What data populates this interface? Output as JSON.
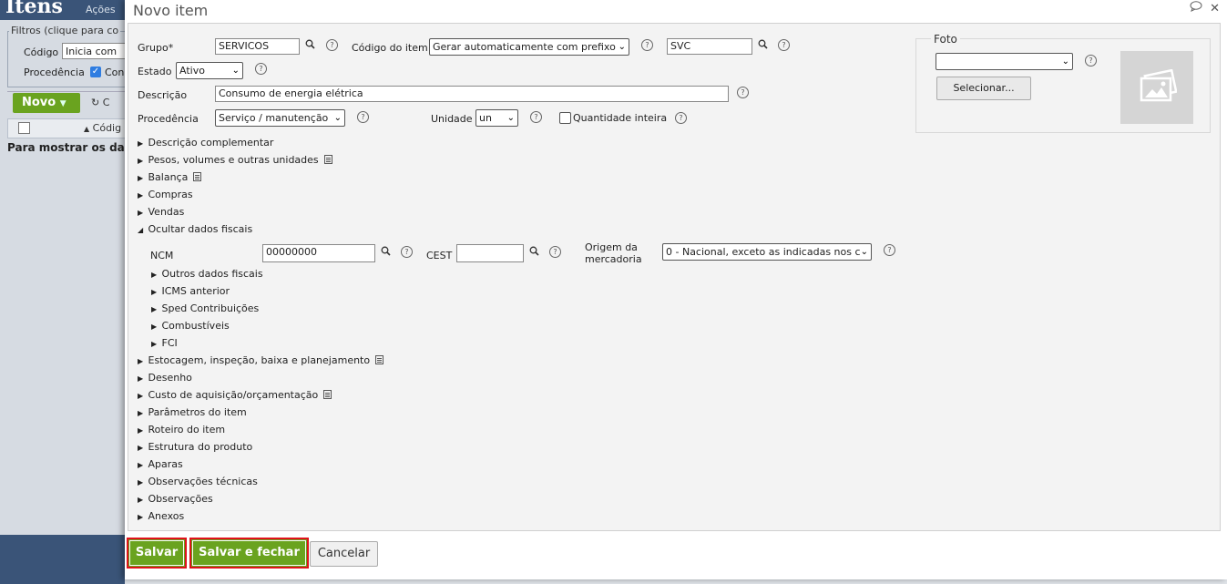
{
  "background": {
    "title": "Itens",
    "acoes": "Ações",
    "filtros": "Filtros (clique para co",
    "codigo_label": "Código",
    "codigo_select": "Inicia com",
    "procedencia_label": "Procedência",
    "procedencia_check": "Con",
    "novo_label": "Novo",
    "refresh_text": "C",
    "col_codigo": "Códig",
    "empty_text": "Para mostrar os dado"
  },
  "dialog": {
    "title": "Novo item",
    "form": {
      "grupo_label": "Grupo*",
      "grupo_value": "SERVICOS",
      "codigo_item_label": "Código do item",
      "codigo_item_select": "Gerar automaticamente com prefixo",
      "prefixo_value": "SVC",
      "estado_label": "Estado",
      "estado_select": "Ativo",
      "descricao_label": "Descrição",
      "descricao_value": "Consumo de energia elétrica",
      "procedencia_label": "Procedência",
      "procedencia_select": "Serviço / manutenção",
      "unidade_label": "Unidade",
      "unidade_select": "un",
      "quantidade_inteira_label": "Quantidade inteira"
    },
    "foto": {
      "legend": "Foto",
      "select_value": "",
      "button_label": "Selecionar..."
    },
    "sections_top": [
      {
        "label": "Descrição complementar",
        "doc": false
      },
      {
        "label": "Pesos, volumes e outras unidades",
        "doc": true
      },
      {
        "label": "Balança",
        "doc": true
      },
      {
        "label": "Compras",
        "doc": false
      },
      {
        "label": "Vendas",
        "doc": false
      }
    ],
    "fiscal": {
      "toggle_label": "Ocultar dados fiscais",
      "ncm_label": "NCM",
      "ncm_value": "00000000",
      "cest_label": "CEST",
      "cest_value": "",
      "origem_label_1": "Origem da",
      "origem_label_2": "mercadoria",
      "origem_select": "0 - Nacional, exceto as indicadas nos c",
      "subsections": [
        "Outros dados fiscais",
        "ICMS anterior",
        "Sped Contribuições",
        "Combustíveis",
        "FCI"
      ]
    },
    "sections_bottom": [
      {
        "label": "Estocagem, inspeção, baixa e planejamento",
        "doc": true
      },
      {
        "label": "Desenho",
        "doc": false
      },
      {
        "label": "Custo de aquisição/orçamentação",
        "doc": true
      },
      {
        "label": "Parâmetros do item",
        "doc": false
      },
      {
        "label": "Roteiro do item",
        "doc": false
      },
      {
        "label": "Estrutura do produto",
        "doc": false
      },
      {
        "label": "Aparas",
        "doc": false
      },
      {
        "label": "Observações técnicas",
        "doc": false
      },
      {
        "label": "Observações",
        "doc": false
      },
      {
        "label": "Anexos",
        "doc": false
      }
    ],
    "buttons": {
      "salvar": "Salvar",
      "salvar_fechar": "Salvar e fechar",
      "cancelar": "Cancelar"
    }
  },
  "icons": {
    "help": "?",
    "search": "🔍",
    "chevron": "⌄",
    "chat": "💬",
    "close": "✕"
  }
}
